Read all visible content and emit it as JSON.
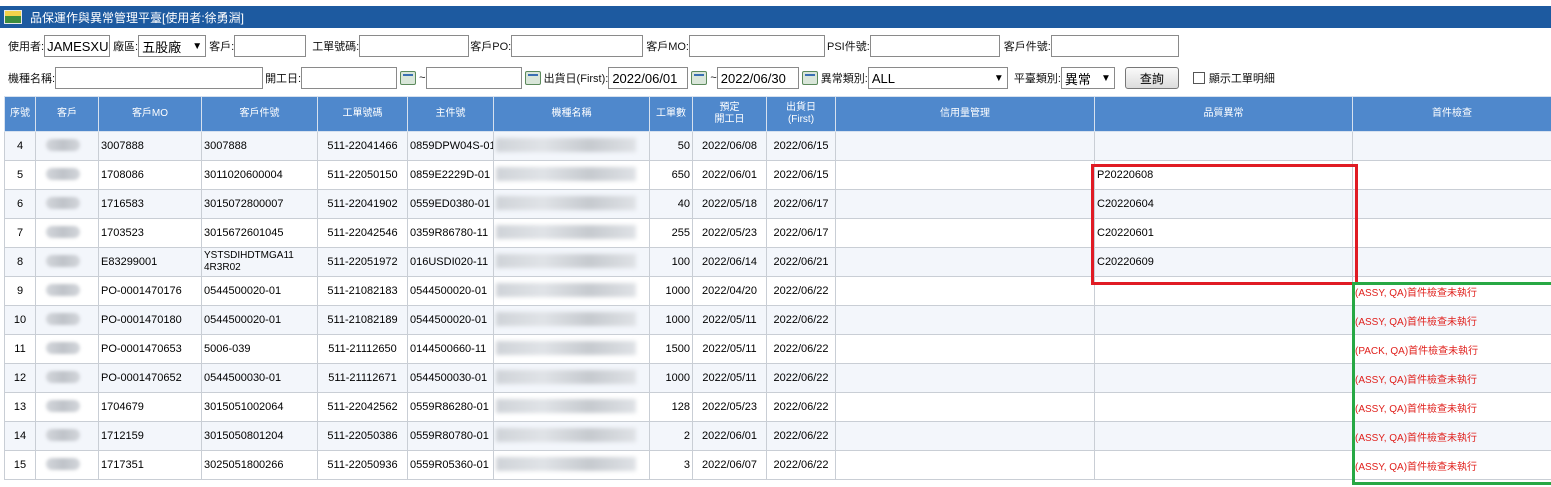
{
  "window": {
    "title": "品保運作與異常管理平臺[使用者:徐勇淵]"
  },
  "filters": {
    "user_label": "使用者:",
    "user_value": "JAMESXU",
    "plant_label": "廠區:",
    "plant_value": "五股廠",
    "customer_label": "客戶:",
    "customer_value": "",
    "work_order_label": "工單號碼:",
    "work_order_value": "",
    "customer_po_label": "客戶PO:",
    "customer_po_value": "",
    "customer_mo_label": "客戶MO:",
    "customer_mo_value": "",
    "psi_part_label": "PSI件號:",
    "psi_part_value": "",
    "customer_part_label": "客戶件號:",
    "customer_part_value": "",
    "model_name_label": "機種名稱:",
    "model_name_value": "",
    "start_date_label": "開工日:",
    "start_date_from": "",
    "start_date_to": "",
    "ship_date_label": "出貨日(First):",
    "ship_date_from": "2022/06/01",
    "ship_date_to": "2022/06/30",
    "range_sep": "~",
    "abnormal_type_label": "異常類別:",
    "abnormal_type_value": "ALL",
    "platform_type_label": "平臺類別:",
    "platform_type_value": "異常",
    "query_button": "查詢",
    "show_detail_label": "顯示工單明細"
  },
  "table": {
    "columns": [
      "序號",
      "客戶",
      "客戶MO",
      "客戶件號",
      "工單號碼",
      "主件號",
      "機種名稱",
      "工單數",
      "預定\n開工日",
      "出貨日\n(First)",
      "信用量管理",
      "品質異常",
      "首件檢查"
    ],
    "rows": [
      {
        "seq": "4",
        "mo": "3007888",
        "part": "3007888",
        "wo": "511-22041466",
        "main": "0859DPW04S-01",
        "qty": "50",
        "start": "2022/06/08",
        "ship": "2022/06/15",
        "credit": "",
        "quality": "",
        "first_check": ""
      },
      {
        "seq": "5",
        "mo": "1708086",
        "part": "3011020600004",
        "wo": "511-22050150",
        "main": "0859E2229D-01",
        "qty": "650",
        "start": "2022/06/01",
        "ship": "2022/06/15",
        "credit": "",
        "quality": "P20220608",
        "first_check": ""
      },
      {
        "seq": "6",
        "mo": "1716583",
        "part": "3015072800007",
        "wo": "511-22041902",
        "main": "0559ED0380-01",
        "qty": "40",
        "start": "2022/05/18",
        "ship": "2022/06/17",
        "credit": "",
        "quality": "C20220604",
        "first_check": ""
      },
      {
        "seq": "7",
        "mo": "1703523",
        "part": "3015672601045",
        "wo": "511-22042546",
        "main": "0359R86780-11",
        "qty": "255",
        "start": "2022/05/23",
        "ship": "2022/06/17",
        "credit": "",
        "quality": "C20220601",
        "first_check": ""
      },
      {
        "seq": "8",
        "mo": "E83299001",
        "part": "YSTSDIHDTMGA11 4R3R02",
        "wo": "511-22051972",
        "main": "016USDI020-11",
        "qty": "100",
        "start": "2022/06/14",
        "ship": "2022/06/21",
        "credit": "",
        "quality": "C20220609",
        "first_check": ""
      },
      {
        "seq": "9",
        "mo": "PO-0001470176",
        "part": "0544500020-01",
        "wo": "511-21082183",
        "main": "0544500020-01",
        "qty": "1000",
        "start": "2022/04/20",
        "ship": "2022/06/22",
        "credit": "",
        "quality": "",
        "first_check": "(ASSY, QA)首件檢查未執行"
      },
      {
        "seq": "10",
        "mo": "PO-0001470180",
        "part": "0544500020-01",
        "wo": "511-21082189",
        "main": "0544500020-01",
        "qty": "1000",
        "start": "2022/05/11",
        "ship": "2022/06/22",
        "credit": "",
        "quality": "",
        "first_check": "(ASSY, QA)首件檢查未執行"
      },
      {
        "seq": "11",
        "mo": "PO-0001470653",
        "part": "5006-039",
        "wo": "511-21112650",
        "main": "0144500660-11",
        "qty": "1500",
        "start": "2022/05/11",
        "ship": "2022/06/22",
        "credit": "",
        "quality": "",
        "first_check": "(PACK, QA)首件檢查未執行"
      },
      {
        "seq": "12",
        "mo": "PO-0001470652",
        "part": "0544500030-01",
        "wo": "511-21112671",
        "main": "0544500030-01",
        "qty": "1000",
        "start": "2022/05/11",
        "ship": "2022/06/22",
        "credit": "",
        "quality": "",
        "first_check": "(ASSY, QA)首件檢查未執行"
      },
      {
        "seq": "13",
        "mo": "1704679",
        "part": "3015051002064",
        "wo": "511-22042562",
        "main": "0559R86280-01",
        "qty": "128",
        "start": "2022/05/23",
        "ship": "2022/06/22",
        "credit": "",
        "quality": "",
        "first_check": "(ASSY, QA)首件檢查未執行"
      },
      {
        "seq": "14",
        "mo": "1712159",
        "part": "3015050801204",
        "wo": "511-22050386",
        "main": "0559R80780-01",
        "qty": "2",
        "start": "2022/06/01",
        "ship": "2022/06/22",
        "credit": "",
        "quality": "",
        "first_check": "(ASSY, QA)首件檢查未執行"
      },
      {
        "seq": "15",
        "mo": "1717351",
        "part": "3025051800266",
        "wo": "511-22050936",
        "main": "0559R05360-01",
        "qty": "3",
        "start": "2022/06/07",
        "ship": "2022/06/22",
        "credit": "",
        "quality": "",
        "first_check": "(ASSY, QA)首件檢查未執行"
      }
    ]
  },
  "colors": {
    "header_bg": "#4f88cc",
    "title_bg": "#1d5aa0",
    "alert_text": "#e0201c",
    "highlight_red": "#e01b24",
    "highlight_green": "#27a844"
  }
}
